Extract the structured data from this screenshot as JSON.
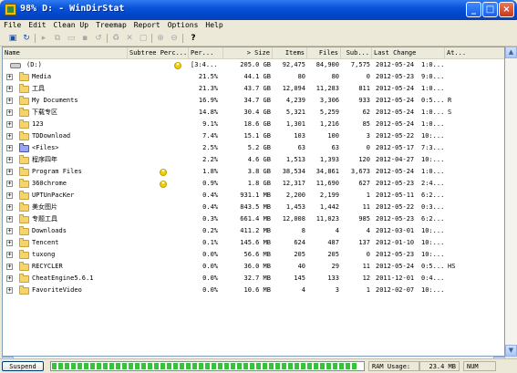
{
  "window": {
    "title": "98% D: - WinDirStat"
  },
  "menu": [
    "File",
    "Edit",
    "Clean Up",
    "Treemap",
    "Report",
    "Options",
    "Help"
  ],
  "toolbar_icons": [
    "open-icon",
    "refresh-icon",
    "play-icon",
    "copy-icon",
    "explorer-icon",
    "cmd-icon",
    "refresh-selected-icon",
    "recycle-icon",
    "delete-icon",
    "properties-icon",
    "zoom-in-icon",
    "zoom-out-icon",
    "help-icon"
  ],
  "columns": [
    "Name",
    "Subtree Perc...",
    "Per...",
    "> Size",
    "Items",
    "Files",
    "Sub...",
    "Last Change",
    "At..."
  ],
  "root": {
    "name": "(D:)",
    "subtree": "[3:4...",
    "size": "205.0 GB",
    "items": "92,475",
    "files": "84,900",
    "subdirs": "7,575",
    "last_change": "2012-05-24",
    "time": "1:0...",
    "attr": ""
  },
  "rows": [
    {
      "name": "Media",
      "percent": "21.5%",
      "size": "44.1 GB",
      "items": "80",
      "files": "80",
      "subdirs": "0",
      "last_change": "2012-05-23",
      "time": "9:0...",
      "attr": "",
      "folder": "yellow"
    },
    {
      "name": "工具",
      "percent": "21.3%",
      "size": "43.7 GB",
      "items": "12,094",
      "files": "11,283",
      "subdirs": "811",
      "last_change": "2012-05-24",
      "time": "1:0...",
      "attr": "",
      "folder": "yellow"
    },
    {
      "name": "My Documents",
      "percent": "16.9%",
      "size": "34.7 GB",
      "items": "4,239",
      "files": "3,306",
      "subdirs": "933",
      "last_change": "2012-05-24",
      "time": "0:5...",
      "attr": "R",
      "folder": "yellow"
    },
    {
      "name": "下载专区",
      "percent": "14.8%",
      "size": "30.4 GB",
      "items": "5,321",
      "files": "5,259",
      "subdirs": "62",
      "last_change": "2012-05-24",
      "time": "1:0...",
      "attr": "S",
      "folder": "yellow"
    },
    {
      "name": "123",
      "percent": "9.1%",
      "size": "18.6 GB",
      "items": "1,301",
      "files": "1,216",
      "subdirs": "85",
      "last_change": "2012-05-24",
      "time": "1:0...",
      "attr": "",
      "folder": "yellow"
    },
    {
      "name": "TDDownload",
      "percent": "7.4%",
      "size": "15.1 GB",
      "items": "103",
      "files": "100",
      "subdirs": "3",
      "last_change": "2012-05-22",
      "time": "10:...",
      "attr": "",
      "folder": "yellow"
    },
    {
      "name": "<Files>",
      "percent": "2.5%",
      "size": "5.2 GB",
      "items": "63",
      "files": "63",
      "subdirs": "0",
      "last_change": "2012-05-17",
      "time": "7:3...",
      "attr": "",
      "folder": "blue"
    },
    {
      "name": "程序四年",
      "percent": "2.2%",
      "size": "4.6 GB",
      "items": "1,513",
      "files": "1,393",
      "subdirs": "120",
      "last_change": "2012-04-27",
      "time": "10:...",
      "attr": "",
      "folder": "yellow"
    },
    {
      "name": "Program Files",
      "percent": "1.8%",
      "size": "3.8 GB",
      "items": "38,534",
      "files": "34,861",
      "subdirs": "3,673",
      "last_change": "2012-05-24",
      "time": "1:0...",
      "attr": "",
      "folder": "yellow",
      "pac": true
    },
    {
      "name": "360chrome",
      "percent": "0.9%",
      "size": "1.8 GB",
      "items": "12,317",
      "files": "11,690",
      "subdirs": "627",
      "last_change": "2012-05-23",
      "time": "2:4...",
      "attr": "",
      "folder": "yellow",
      "pac": true
    },
    {
      "name": "UPTUnPacKer",
      "percent": "0.4%",
      "size": "931.1 MB",
      "items": "2,200",
      "files": "2,199",
      "subdirs": "1",
      "last_change": "2012-05-11",
      "time": "6:2...",
      "attr": "",
      "folder": "yellow"
    },
    {
      "name": "美女图片",
      "percent": "0.4%",
      "size": "843.5 MB",
      "items": "1,453",
      "files": "1,442",
      "subdirs": "11",
      "last_change": "2012-05-22",
      "time": "0:3...",
      "attr": "",
      "folder": "yellow"
    },
    {
      "name": "专题工具",
      "percent": "0.3%",
      "size": "661.4 MB",
      "items": "12,008",
      "files": "11,023",
      "subdirs": "985",
      "last_change": "2012-05-23",
      "time": "6:2...",
      "attr": "",
      "folder": "yellow"
    },
    {
      "name": "Downloads",
      "percent": "0.2%",
      "size": "411.2 MB",
      "items": "8",
      "files": "4",
      "subdirs": "4",
      "last_change": "2012-03-01",
      "time": "10:...",
      "attr": "",
      "folder": "yellow"
    },
    {
      "name": "Tencent",
      "percent": "0.1%",
      "size": "145.6 MB",
      "items": "624",
      "files": "487",
      "subdirs": "137",
      "last_change": "2012-01-10",
      "time": "10:...",
      "attr": "",
      "folder": "yellow"
    },
    {
      "name": "tuxong",
      "percent": "0.0%",
      "size": "56.6 MB",
      "items": "205",
      "files": "205",
      "subdirs": "0",
      "last_change": "2012-05-23",
      "time": "10:...",
      "attr": "",
      "folder": "yellow"
    },
    {
      "name": "RECYCLER",
      "percent": "0.0%",
      "size": "36.0 MB",
      "items": "40",
      "files": "29",
      "subdirs": "11",
      "last_change": "2012-05-24",
      "time": "0:5...",
      "attr": "HS",
      "folder": "yellow"
    },
    {
      "name": "CheatEngine5.6.1",
      "percent": "0.0%",
      "size": "32.7 MB",
      "items": "145",
      "files": "133",
      "subdirs": "12",
      "last_change": "2011-12-01",
      "time": "0:4...",
      "attr": "",
      "folder": "yellow"
    },
    {
      "name": "FavoriteVideo",
      "percent": "0.0%",
      "size": "10.6 MB",
      "items": "4",
      "files": "3",
      "subdirs": "1",
      "last_change": "2012-02-07",
      "time": "10:...",
      "attr": "",
      "folder": "yellow"
    }
  ],
  "status": {
    "suspend_label": "Suspend",
    "progress": 0.98,
    "ram_label": "RAM Usage:",
    "ram_value": "23.4 MB",
    "num": "NUM"
  }
}
